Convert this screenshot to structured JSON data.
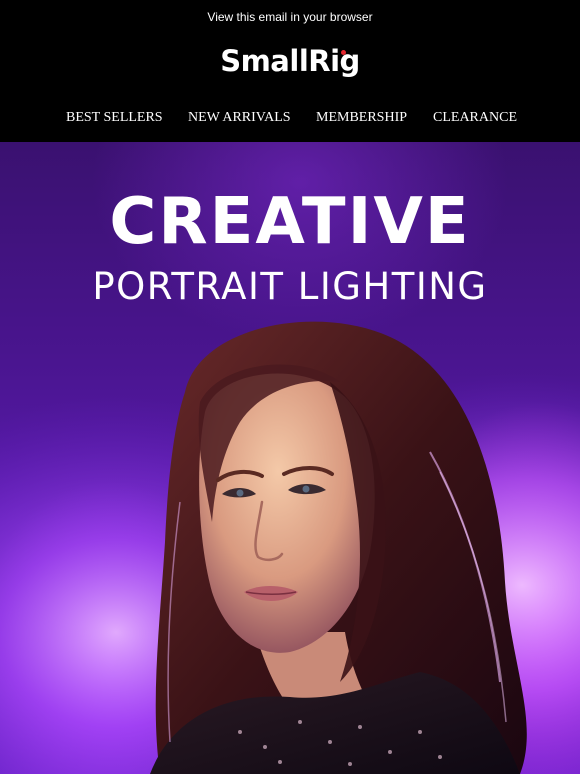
{
  "header": {
    "view_in_browser": "View this email in your browser",
    "logo_text": "SmallRig",
    "brand_accent": "#e3262f",
    "background": "#000000"
  },
  "nav": {
    "items": [
      {
        "label": "BEST SELLERS"
      },
      {
        "label": "NEW ARRIVALS"
      },
      {
        "label": "MEMBERSHIP"
      },
      {
        "label": "CLEARANCE"
      }
    ]
  },
  "hero": {
    "headline": "CREATIVE",
    "subheadline": "PORTRAIT LIGHTING",
    "image_subject": "portrait of woman under purple lighting",
    "background_color": "#4a1590",
    "accent_color": "#b04dff"
  }
}
